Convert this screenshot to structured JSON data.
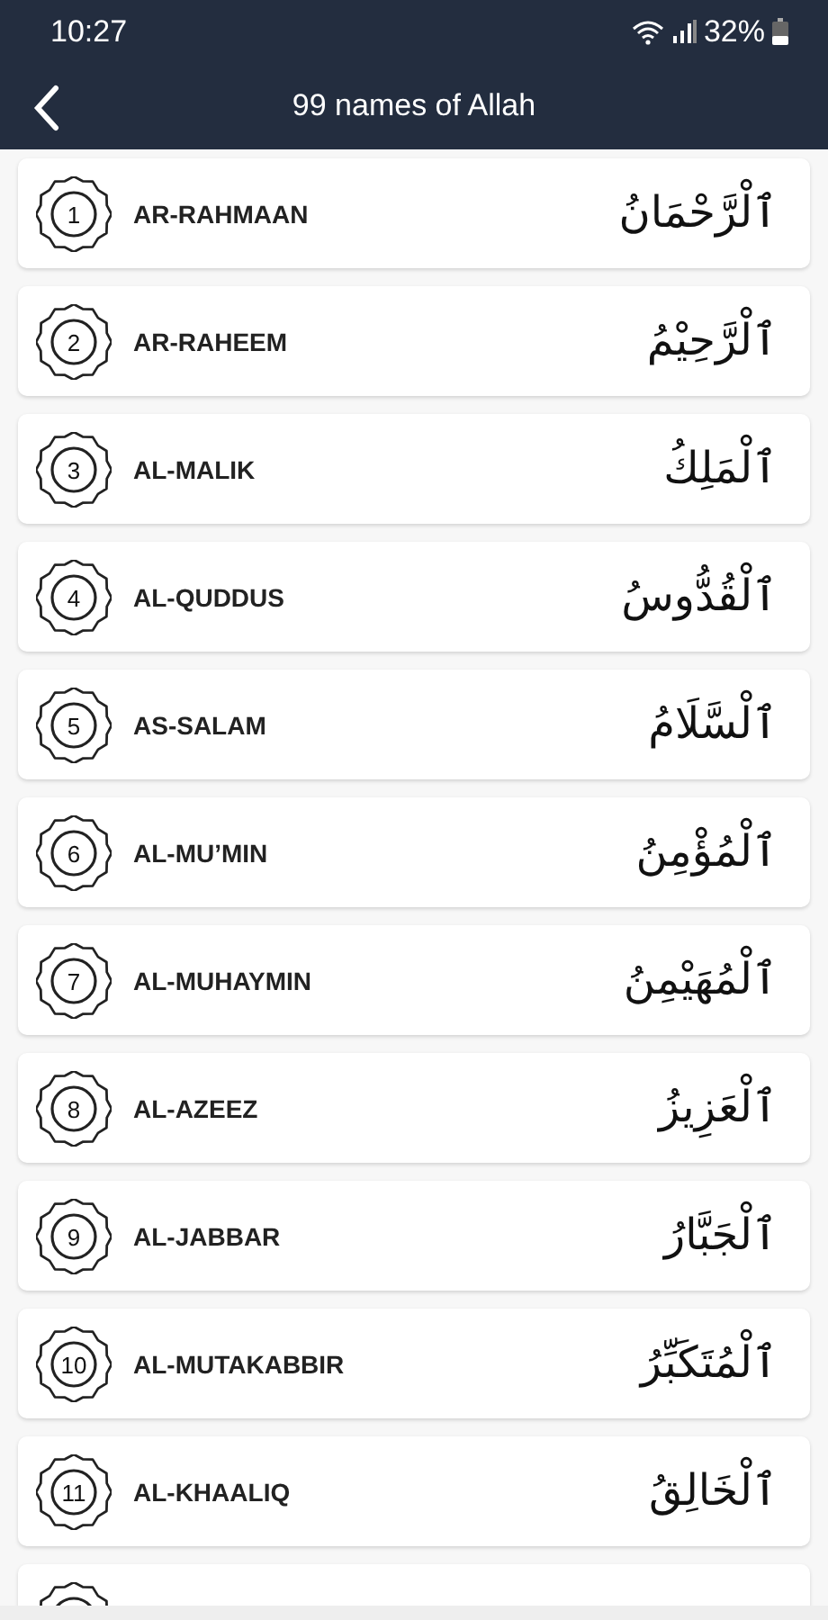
{
  "status_bar": {
    "time": "10:27",
    "battery": "32%"
  },
  "header": {
    "title": "99 names of Allah"
  },
  "names": [
    {
      "kind": "name",
      "number": "1",
      "transliteration": "AR-RAHMAAN",
      "arabic": "ٱلْرَّحْمَانُ"
    },
    {
      "kind": "name",
      "number": "2",
      "transliteration": "AR-RAHEEM",
      "arabic": "ٱلْرَّحِيْمُ"
    },
    {
      "kind": "name",
      "number": "3",
      "transliteration": "AL-MALIK",
      "arabic": "ٱلْمَلِكُ"
    },
    {
      "kind": "name",
      "number": "4",
      "transliteration": "AL-QUDDUS",
      "arabic": "ٱلْقُدُّوسُ"
    },
    {
      "kind": "name",
      "number": "5",
      "transliteration": "AS-SALAM",
      "arabic": "ٱلْسَّلَامُ"
    },
    {
      "kind": "name",
      "number": "6",
      "transliteration": "AL-MU’MIN",
      "arabic": "ٱلْمُؤْمِنُ"
    },
    {
      "kind": "name",
      "number": "7",
      "transliteration": "AL-MUHAYMIN",
      "arabic": "ٱلْمُهَيْمِنُ"
    },
    {
      "kind": "name",
      "number": "8",
      "transliteration": "AL-AZEEZ",
      "arabic": "ٱلْعَزِيزُ"
    },
    {
      "kind": "name",
      "number": "9",
      "transliteration": "AL-JABBAR",
      "arabic": "ٱلْجَبَّارُ"
    },
    {
      "kind": "name",
      "number": "10",
      "transliteration": "AL-MUTAKABBIR",
      "arabic": "ٱلْمُتَكَبِّرُ"
    },
    {
      "kind": "name",
      "number": "11",
      "transliteration": "AL-KHAALIQ",
      "arabic": "ٱلْخَالِقُ"
    },
    {
      "kind": "partial"
    }
  ]
}
